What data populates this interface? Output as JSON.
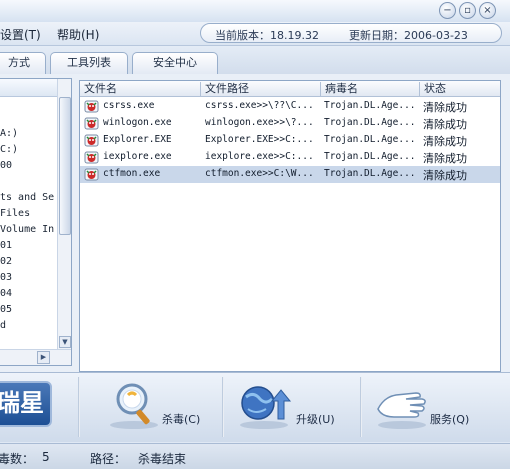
{
  "window": {
    "min_glyph": "−",
    "restore_glyph": "▫",
    "close_glyph": "×"
  },
  "menu": {
    "settings": "设置(T)",
    "help": "帮助(H)"
  },
  "version": {
    "current": "当前版本：18.19.32",
    "updated": "更新日期：2006-03-23"
  },
  "tabs": [
    "方式",
    "工具列表",
    "安全中心"
  ],
  "tree": {
    "lines": [
      "A:)",
      "C:)",
      "00",
      "",
      "ts and Se",
      " Files",
      "Volume In",
      "01",
      "02",
      "03",
      "04",
      "05",
      "d"
    ],
    "scroll_down_glyph": "▼",
    "scroll_right_glyph": "▶"
  },
  "list": {
    "columns": [
      "文件名",
      "文件路径",
      "病毒名",
      "状态"
    ],
    "rows": [
      {
        "name": "csrss.exe",
        "path": "csrss.exe>>\\??\\C...",
        "virus": "Trojan.DL.Age...",
        "status": "清除成功"
      },
      {
        "name": "winlogon.exe",
        "path": "winlogon.exe>>\\?...",
        "virus": "Trojan.DL.Age...",
        "status": "清除成功"
      },
      {
        "name": "Explorer.EXE",
        "path": "Explorer.EXE>>C:...",
        "virus": "Trojan.DL.Age...",
        "status": "清除成功"
      },
      {
        "name": "iexplore.exe",
        "path": "iexplore.exe>>C:...",
        "virus": "Trojan.DL.Age...",
        "status": "清除成功"
      },
      {
        "name": "ctfmon.exe",
        "path": "ctfmon.exe>>C:\\W...",
        "virus": "Trojan.DL.Age...",
        "status": "清除成功"
      }
    ],
    "selected_row_index": 4
  },
  "actions": {
    "brand": "瑞星",
    "scan": "杀毒(C)",
    "upgrade": "升级(U)",
    "service": "服务(Q)"
  },
  "status": {
    "count_label": "毒数：",
    "count": "5",
    "path_label": "路径：",
    "path_value": "杀毒结束"
  },
  "colors": {
    "accent": "#1d4f94",
    "selection": "#c9d7ea",
    "border": "#8da6c6"
  }
}
